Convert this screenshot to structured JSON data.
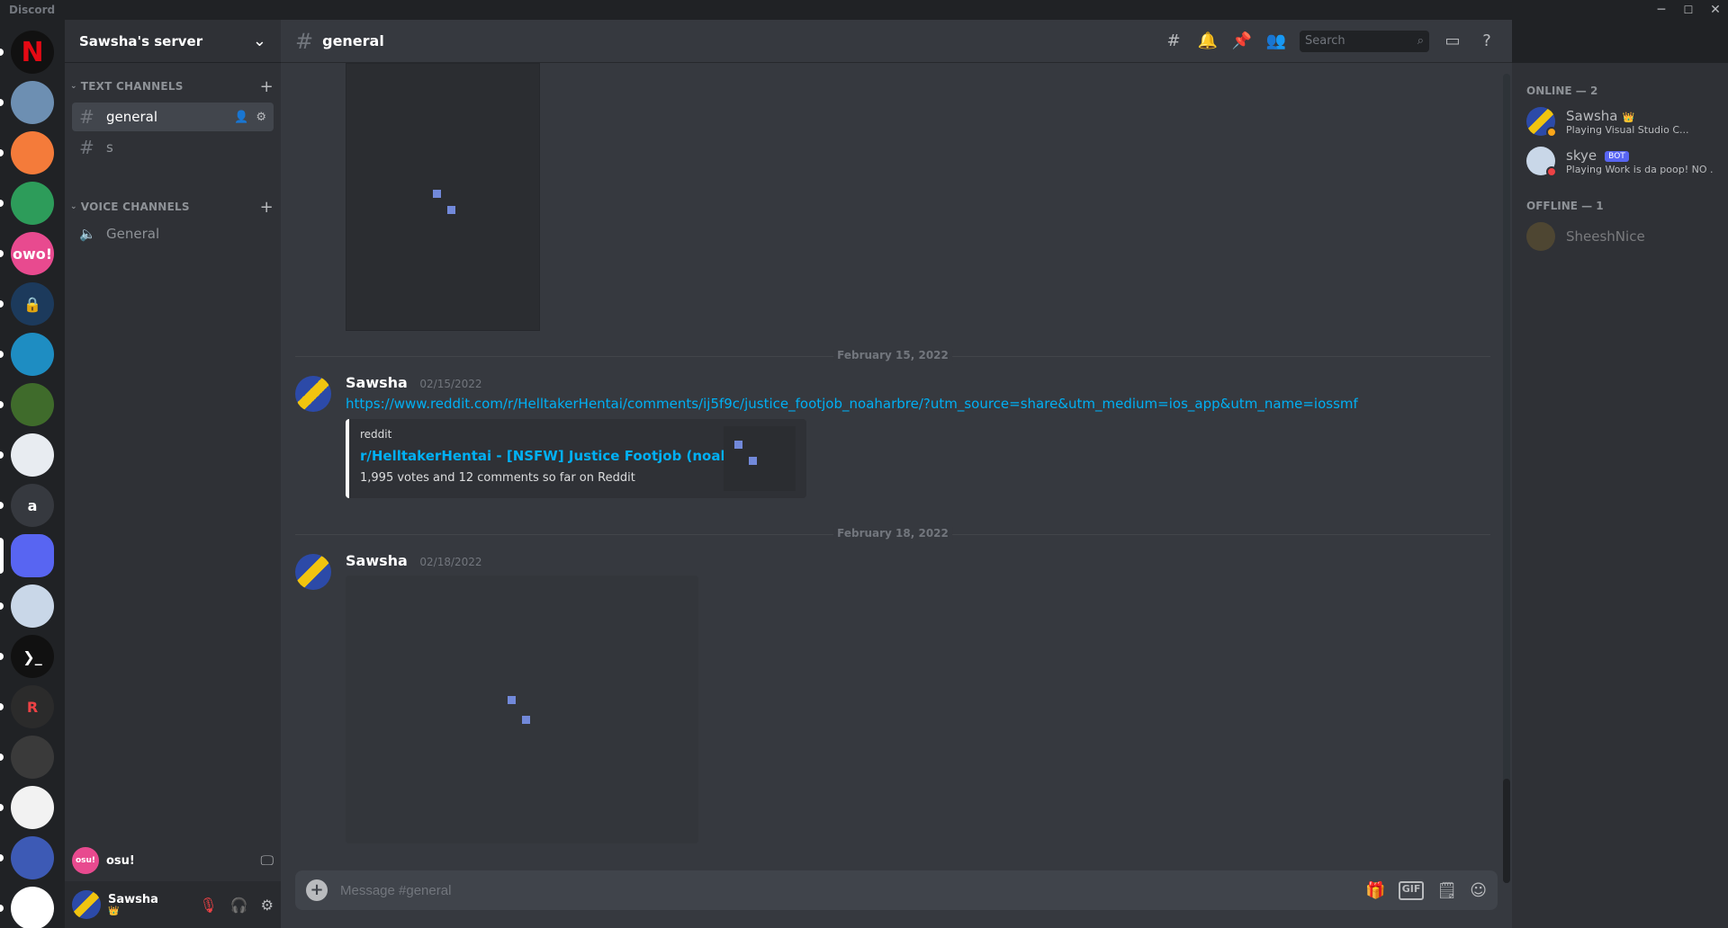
{
  "window": {
    "app_name": "Discord",
    "minimize": "─",
    "maximize": "☐",
    "close": "✕"
  },
  "servers": [
    {
      "name": "N",
      "color": "#e50914",
      "selected": false
    },
    {
      "name": "",
      "color": "#6d8fb2",
      "selected": false
    },
    {
      "name": "",
      "color": "#f47b3a",
      "selected": false
    },
    {
      "name": "",
      "color": "#2d9c5a",
      "selected": false
    },
    {
      "name": "owo!",
      "color": "#e84a8f",
      "selected": false
    },
    {
      "name": "🔒",
      "color": "#1c3a5c",
      "selected": false
    },
    {
      "name": "",
      "color": "#1e8dc2",
      "selected": false
    },
    {
      "name": "",
      "color": "#3f6b2b",
      "selected": false
    },
    {
      "name": "",
      "color": "#e8ecf1",
      "selected": false
    },
    {
      "name": "a",
      "color": "#36393f",
      "selected": false
    },
    {
      "name": "",
      "color": "#5865f2",
      "selected": true
    },
    {
      "name": "",
      "color": "#c9d7e8",
      "selected": false
    },
    {
      "name": "❯_",
      "color": "#111111",
      "selected": false
    },
    {
      "name": "R",
      "color": "#2b2b2b",
      "selected": false
    },
    {
      "name": "",
      "color": "#3a3a3a",
      "selected": false
    },
    {
      "name": "",
      "color": "#f2f2f2",
      "selected": false
    },
    {
      "name": "",
      "color": "#3d5ab5",
      "selected": false
    },
    {
      "name": "",
      "color": "#ffffff",
      "selected": false
    }
  ],
  "sidebar": {
    "server_name": "Sawsha's server",
    "chevron": "⌄",
    "text_category": "TEXT CHANNELS",
    "voice_category": "VOICE CHANNELS",
    "add": "+",
    "text_channels": [
      {
        "name": "general",
        "active": true
      },
      {
        "name": "s",
        "active": false
      }
    ],
    "voice_channels": [
      {
        "name": "General"
      }
    ]
  },
  "activity": {
    "name": "osu!",
    "icon_text": "osu!"
  },
  "user": {
    "name": "Sawsha",
    "status_icon": "👑"
  },
  "header": {
    "channel": "general",
    "search_placeholder": "Search"
  },
  "messages": {
    "date1": "February 15, 2022",
    "msg1": {
      "author": "Sawsha",
      "timestamp": "02/15/2022",
      "link": "https://www.reddit.com/r/HelltakerHentai/comments/ij5f9c/justice_footjob_noaharbre/?utm_source=share&utm_medium=ios_app&utm_name=iossmf",
      "embed_provider": "reddit",
      "embed_title": "r/HelltakerHentai - [NSFW] Justice Footjob (noaharbre)",
      "embed_desc": "1,995 votes and 12 comments so far on Reddit"
    },
    "date2": "February 18, 2022",
    "msg2": {
      "author": "Sawsha",
      "timestamp": "02/18/2022"
    }
  },
  "composer": {
    "placeholder": "Message #general",
    "add_icon": "+"
  },
  "members": {
    "online_header": "ONLINE — 2",
    "offline_header": "OFFLINE — 1",
    "online": [
      {
        "name": "Sawsha",
        "activity": "Playing Visual Studio C...",
        "crown": "👑"
      },
      {
        "name": "skye",
        "badge": "BOT",
        "activity": "Playing Work is da poop! NO ..."
      }
    ],
    "offline": [
      {
        "name": "SheeshNice"
      }
    ]
  },
  "colors": {
    "accent": "#5865f2",
    "link": "#00b0f4",
    "loader": "#7289da"
  }
}
